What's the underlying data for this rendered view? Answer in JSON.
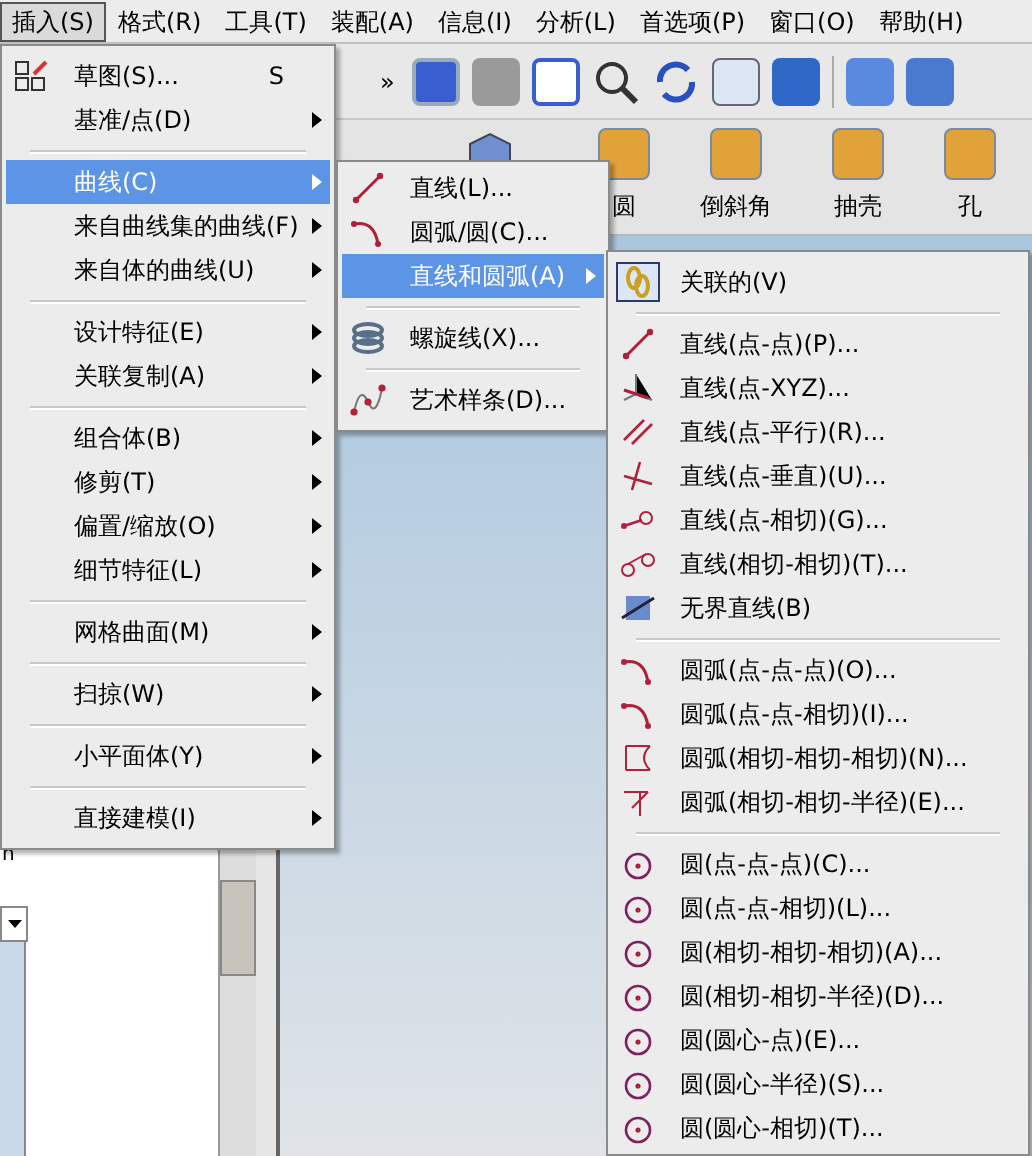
{
  "menubar": [
    {
      "label": "插入(S)",
      "selected": true
    },
    {
      "label": "格式(R)",
      "selected": false
    },
    {
      "label": "工具(T)",
      "selected": false
    },
    {
      "label": "装配(A)",
      "selected": false
    },
    {
      "label": "信息(I)",
      "selected": false
    },
    {
      "label": "分析(L)",
      "selected": false
    },
    {
      "label": "首选项(P)",
      "selected": false
    },
    {
      "label": "窗口(O)",
      "selected": false
    },
    {
      "label": "帮助(H)",
      "selected": false
    }
  ],
  "toolbar": {
    "overflow": "»"
  },
  "feature_toolbar": [
    {
      "label": "圆"
    },
    {
      "label": "倒斜角"
    },
    {
      "label": "抽壳"
    },
    {
      "label": "孔"
    }
  ],
  "side_panel": {
    "text": "n"
  },
  "menus": [
    {
      "items": [
        {
          "kind": "item",
          "label": "草图(S)...",
          "shortcut": "S",
          "submenu": false,
          "selected": false
        },
        {
          "kind": "item",
          "label": "基准/点(D)",
          "submenu": true,
          "selected": false
        },
        {
          "kind": "separator"
        },
        {
          "kind": "item",
          "label": "曲线(C)",
          "submenu": true,
          "selected": true
        },
        {
          "kind": "item",
          "label": "来自曲线集的曲线(F)",
          "submenu": true,
          "selected": false
        },
        {
          "kind": "item",
          "label": "来自体的曲线(U)",
          "submenu": true,
          "selected": false
        },
        {
          "kind": "separator"
        },
        {
          "kind": "item",
          "label": "设计特征(E)",
          "submenu": true,
          "selected": false
        },
        {
          "kind": "item",
          "label": "关联复制(A)",
          "submenu": true,
          "selected": false
        },
        {
          "kind": "separator"
        },
        {
          "kind": "item",
          "label": "组合体(B)",
          "submenu": true,
          "selected": false
        },
        {
          "kind": "item",
          "label": "修剪(T)",
          "submenu": true,
          "selected": false
        },
        {
          "kind": "item",
          "label": "偏置/缩放(O)",
          "submenu": true,
          "selected": false
        },
        {
          "kind": "item",
          "label": "细节特征(L)",
          "submenu": true,
          "selected": false
        },
        {
          "kind": "separator"
        },
        {
          "kind": "item",
          "label": "网格曲面(M)",
          "submenu": true,
          "selected": false
        },
        {
          "kind": "separator"
        },
        {
          "kind": "item",
          "label": "扫掠(W)",
          "submenu": true,
          "selected": false
        },
        {
          "kind": "separator"
        },
        {
          "kind": "item",
          "label": "小平面体(Y)",
          "submenu": true,
          "selected": false
        },
        {
          "kind": "separator"
        },
        {
          "kind": "item",
          "label": "直接建模(I)",
          "submenu": true,
          "selected": false
        }
      ]
    },
    {
      "items": [
        {
          "kind": "item",
          "label": "直线(L)...",
          "submenu": false,
          "selected": false
        },
        {
          "kind": "item",
          "label": "圆弧/圆(C)...",
          "submenu": false,
          "selected": false
        },
        {
          "kind": "item",
          "label": "直线和圆弧(A)",
          "submenu": true,
          "selected": true
        },
        {
          "kind": "separator"
        },
        {
          "kind": "item",
          "label": "螺旋线(X)...",
          "submenu": false,
          "selected": false
        },
        {
          "kind": "separator"
        },
        {
          "kind": "item",
          "label": "艺术样条(D)...",
          "submenu": false,
          "selected": false
        }
      ]
    },
    {
      "items": [
        {
          "kind": "item",
          "label": "关联的(V)",
          "submenu": false,
          "selected": false,
          "checked": true
        },
        {
          "kind": "separator"
        },
        {
          "kind": "item",
          "label": "直线(点-点)(P)...",
          "submenu": false,
          "selected": false,
          "checked": false
        },
        {
          "kind": "item",
          "label": "直线(点-XYZ)...",
          "submenu": false,
          "selected": false,
          "checked": false
        },
        {
          "kind": "item",
          "label": "直线(点-平行)(R)...",
          "submenu": false,
          "selected": false,
          "checked": false
        },
        {
          "kind": "item",
          "label": "直线(点-垂直)(U)...",
          "submenu": false,
          "selected": false,
          "checked": false
        },
        {
          "kind": "item",
          "label": "直线(点-相切)(G)...",
          "submenu": false,
          "selected": false,
          "checked": false
        },
        {
          "kind": "item",
          "label": "直线(相切-相切)(T)...",
          "submenu": false,
          "selected": false,
          "checked": false
        },
        {
          "kind": "item",
          "label": "无界直线(B)",
          "submenu": false,
          "selected": false,
          "checked": false
        },
        {
          "kind": "separator"
        },
        {
          "kind": "item",
          "label": "圆弧(点-点-点)(O)...",
          "submenu": false,
          "selected": false,
          "checked": false
        },
        {
          "kind": "item",
          "label": "圆弧(点-点-相切)(I)...",
          "submenu": false,
          "selected": false,
          "checked": false
        },
        {
          "kind": "item",
          "label": "圆弧(相切-相切-相切)(N)...",
          "submenu": false,
          "selected": false,
          "checked": false
        },
        {
          "kind": "item",
          "label": "圆弧(相切-相切-半径)(E)...",
          "submenu": false,
          "selected": false,
          "checked": false
        },
        {
          "kind": "separator"
        },
        {
          "kind": "item",
          "label": "圆(点-点-点)(C)...",
          "submenu": false,
          "selected": false,
          "checked": false
        },
        {
          "kind": "item",
          "label": "圆(点-点-相切)(L)...",
          "submenu": false,
          "selected": false,
          "checked": false
        },
        {
          "kind": "item",
          "label": "圆(相切-相切-相切)(A)...",
          "submenu": false,
          "selected": false,
          "checked": false
        },
        {
          "kind": "item",
          "label": "圆(相切-相切-半径)(D)...",
          "submenu": false,
          "selected": false,
          "checked": false
        },
        {
          "kind": "item",
          "label": "圆(圆心-点)(E)...",
          "submenu": false,
          "selected": false,
          "checked": false
        },
        {
          "kind": "item",
          "label": "圆(圆心-半径)(S)...",
          "submenu": false,
          "selected": false,
          "checked": false
        },
        {
          "kind": "item",
          "label": "圆(圆心-相切)(T)...",
          "submenu": false,
          "selected": false,
          "checked": false
        }
      ]
    }
  ]
}
